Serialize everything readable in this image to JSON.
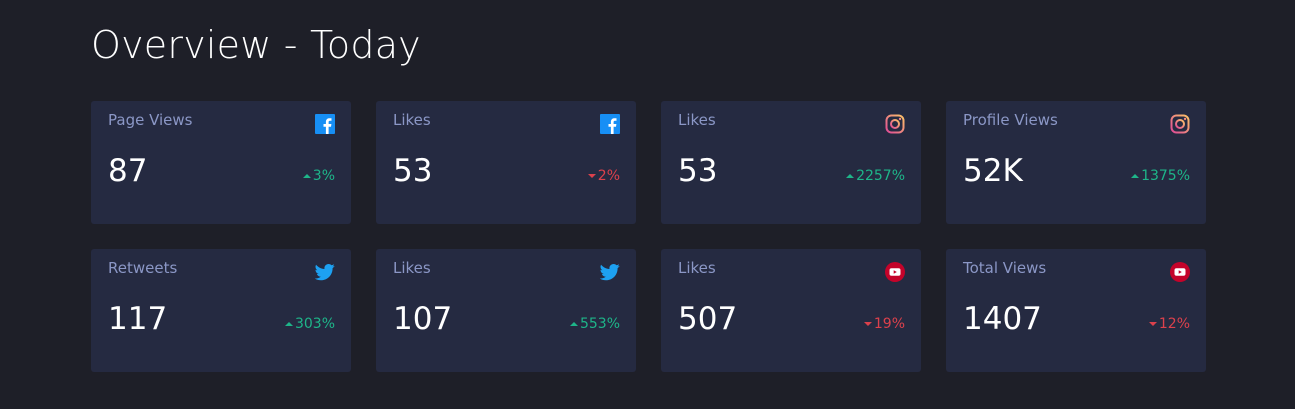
{
  "header": {
    "title": "Overview - Today"
  },
  "colors": {
    "background": "#1e1f28",
    "card": "#252a41",
    "label": "#8b97c6",
    "up": "#1eb589",
    "down": "#dc414c",
    "facebook": "#178ff5",
    "instagram": "#e7a27a",
    "twitter": "#1da1f2",
    "youtube": "#c4032a"
  },
  "cards": [
    {
      "label": "Page Views",
      "value": "87",
      "change": "3%",
      "direction": "up",
      "icon": "facebook-icon"
    },
    {
      "label": "Likes",
      "value": "53",
      "change": "2%",
      "direction": "down",
      "icon": "facebook-icon"
    },
    {
      "label": "Likes",
      "value": "53",
      "change": "2257%",
      "direction": "up",
      "icon": "instagram-icon"
    },
    {
      "label": "Profile Views",
      "value": "52K",
      "change": "1375%",
      "direction": "up",
      "icon": "instagram-icon"
    },
    {
      "label": "Retweets",
      "value": "117",
      "change": "303%",
      "direction": "up",
      "icon": "twitter-icon"
    },
    {
      "label": "Likes",
      "value": "107",
      "change": "553%",
      "direction": "up",
      "icon": "twitter-icon"
    },
    {
      "label": "Likes",
      "value": "507",
      "change": "19%",
      "direction": "down",
      "icon": "youtube-icon"
    },
    {
      "label": "Total Views",
      "value": "1407",
      "change": "12%",
      "direction": "down",
      "icon": "youtube-icon"
    }
  ]
}
